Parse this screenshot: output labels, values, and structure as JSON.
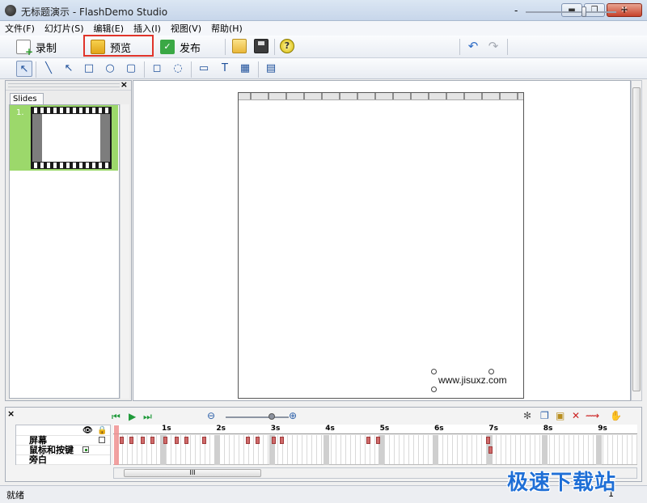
{
  "window": {
    "title": "无标题演示 - FlashDemo Studio",
    "btn_min": "▬",
    "btn_max": "❐",
    "btn_close": "✕"
  },
  "menu": [
    "文件(F)",
    "幻灯片(S)",
    "编辑(E)",
    "插入(I)",
    "视图(V)",
    "帮助(H)"
  ],
  "toolbar": {
    "record_label": "录制",
    "preview_label": "预览",
    "publish_label": "发布",
    "zoom_minus": "-",
    "zoom_plus": "+",
    "zoom_level": 0.64
  },
  "left_panel": {
    "tab_label": "Slides",
    "close": "×",
    "slides": [
      {
        "number": "1."
      }
    ]
  },
  "canvas": {
    "watermark_url": "www.jisuxz.com"
  },
  "timeline": {
    "close": "×",
    "layers": [
      "屏幕",
      "鼠标和按键",
      "旁白"
    ],
    "ticks": [
      "1s",
      "2s",
      "3s",
      "4s",
      "5s",
      "6s",
      "7s",
      "8s",
      "9s"
    ],
    "scroll_grip": "III"
  },
  "status": {
    "text": "就绪",
    "slide_count": "1"
  },
  "site_watermark": "极速下载站",
  "colors": {
    "highlight": "#e0342a",
    "slide_selected": "#9cd86b",
    "marker": "#cf6a6a"
  }
}
